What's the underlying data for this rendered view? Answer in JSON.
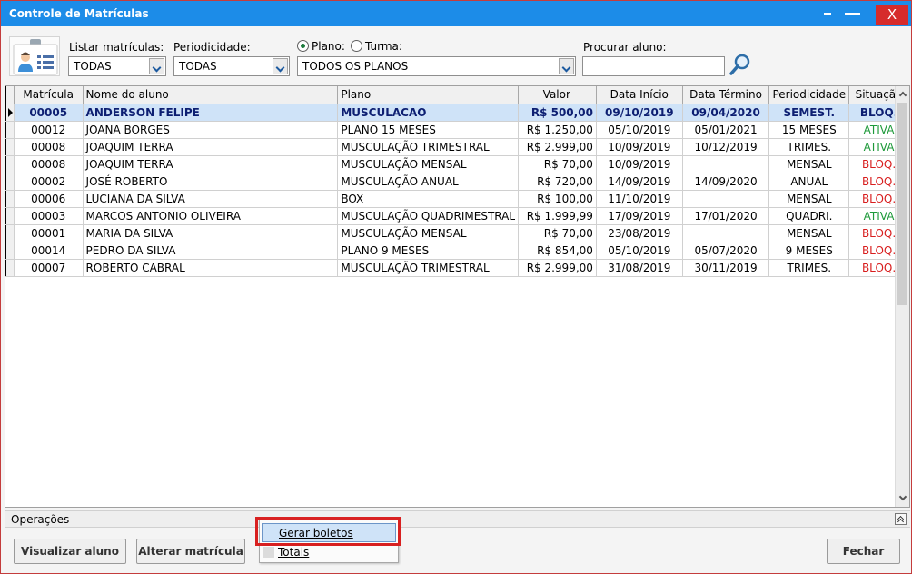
{
  "window": {
    "title": "Controle de Matrículas",
    "close_label": "X"
  },
  "filters": {
    "listar_label": "Listar matrículas:",
    "listar_value": "TODAS",
    "periodicidade_label": "Periodicidade:",
    "periodicidade_value": "TODAS",
    "radio_plano_label": "Plano:",
    "radio_turma_label": "Turma:",
    "plano_value": "TODOS OS PLANOS",
    "procurar_label": "Procurar aluno:",
    "procurar_value": ""
  },
  "grid": {
    "headers": [
      "Matrícula",
      "Nome do aluno",
      "Plano",
      "Valor",
      "Data Início",
      "Data Término",
      "Periodicidade",
      "Situação"
    ],
    "rows": [
      {
        "matricula": "00005",
        "nome": "ANDERSON FELIPE",
        "plano": "MUSCULACAO",
        "valor": "R$ 500,00",
        "inicio": "09/10/2019",
        "termino": "09/04/2020",
        "periodicidade": "SEMEST.",
        "situacao": "BLOQ."
      },
      {
        "matricula": "00012",
        "nome": "JOANA BORGES",
        "plano": "PLANO 15 MESES",
        "valor": "R$ 1.250,00",
        "inicio": "05/10/2019",
        "termino": "05/01/2021",
        "periodicidade": "15 MESES",
        "situacao": "ATIVA"
      },
      {
        "matricula": "00008",
        "nome": "JOAQUIM TERRA",
        "plano": "MUSCULAÇÃO TRIMESTRAL",
        "valor": "R$ 2.999,00",
        "inicio": "10/09/2019",
        "termino": "10/12/2019",
        "periodicidade": "TRIMES.",
        "situacao": "ATIVA"
      },
      {
        "matricula": "00008",
        "nome": "JOAQUIM TERRA",
        "plano": "MUSCULAÇÃO MENSAL",
        "valor": "R$ 70,00",
        "inicio": "10/09/2019",
        "termino": "",
        "periodicidade": "MENSAL",
        "situacao": "BLOQ."
      },
      {
        "matricula": "00002",
        "nome": "JOSÉ ROBERTO",
        "plano": "MUSCULAÇÃO ANUAL",
        "valor": "R$ 720,00",
        "inicio": "14/09/2019",
        "termino": "14/09/2020",
        "periodicidade": "ANUAL",
        "situacao": "BLOQ."
      },
      {
        "matricula": "00006",
        "nome": "LUCIANA DA SILVA",
        "plano": "BOX",
        "valor": "R$ 100,00",
        "inicio": "11/10/2019",
        "termino": "",
        "periodicidade": "MENSAL",
        "situacao": "BLOQ."
      },
      {
        "matricula": "00003",
        "nome": "MARCOS ANTONIO OLIVEIRA",
        "plano": "MUSCULAÇÃO QUADRIMESTRAL",
        "valor": "R$ 1.999,99",
        "inicio": "17/09/2019",
        "termino": "17/01/2020",
        "periodicidade": "QUADRI.",
        "situacao": "ATIVA"
      },
      {
        "matricula": "00001",
        "nome": "MARIA DA SILVA",
        "plano": "MUSCULAÇÃO MENSAL",
        "valor": "R$ 70,00",
        "inicio": "23/08/2019",
        "termino": "",
        "periodicidade": "MENSAL",
        "situacao": "BLOQ."
      },
      {
        "matricula": "00014",
        "nome": "PEDRO DA SILVA",
        "plano": "PLANO 9 MESES",
        "valor": "R$ 854,00",
        "inicio": "05/10/2019",
        "termino": "05/07/2020",
        "periodicidade": "9 MESES",
        "situacao": "BLOQ."
      },
      {
        "matricula": "00007",
        "nome": "ROBERTO CABRAL",
        "plano": "MUSCULAÇÃO TRIMESTRAL",
        "valor": "R$ 2.999,00",
        "inicio": "31/08/2019",
        "termino": "30/11/2019",
        "periodicidade": "TRIMES.",
        "situacao": "BLOQ."
      }
    ]
  },
  "operations": {
    "label": "Operações",
    "visualizar_label": "Visualizar aluno",
    "alterar_label": "Alterar matrícula",
    "fechar_label": "Fechar"
  },
  "popup": {
    "items": [
      {
        "label": "Gerar boletos"
      },
      {
        "label": "Totais"
      }
    ]
  },
  "colors": {
    "titlebar": "#1c8ce8",
    "selected_row": "#cfe3f8",
    "status_ativa": "#1e9a3a",
    "status_bloq": "#d81e1e",
    "highlight": "#d82020"
  },
  "icons": [
    "student-card-icon",
    "magnifier-icon",
    "dropdown-arrow-icon",
    "scroll-up-icon",
    "scroll-down-icon",
    "collapse-icon"
  ]
}
